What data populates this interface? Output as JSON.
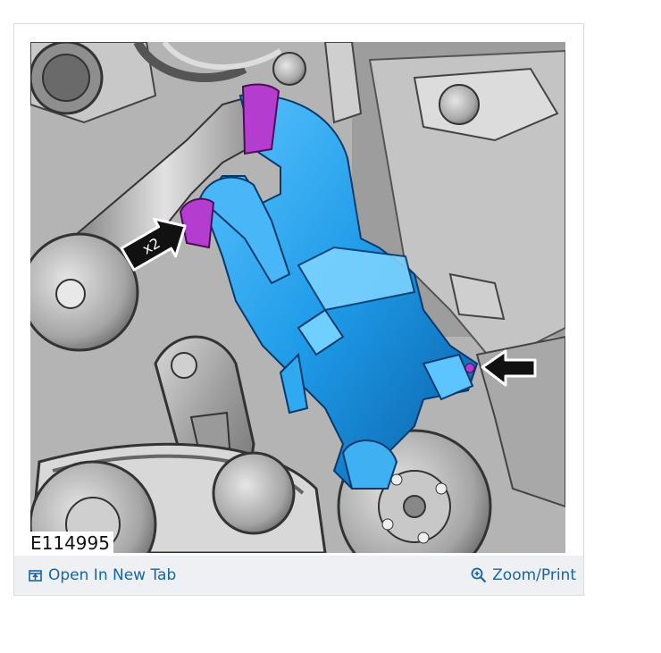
{
  "figure": {
    "id_label": "E114995",
    "callout_label": "x2"
  },
  "footer": {
    "open_tab_label": "Open In New Tab",
    "zoom_print_label": "Zoom/Print"
  },
  "icons": {
    "open_tab": "open-in-new-tab-icon",
    "zoom": "zoom-in-icon"
  },
  "colors": {
    "hose": "#1e9be8",
    "clamp": "#b43ccf",
    "link": "#1565a8",
    "footer_bg": "#eef0f3"
  }
}
